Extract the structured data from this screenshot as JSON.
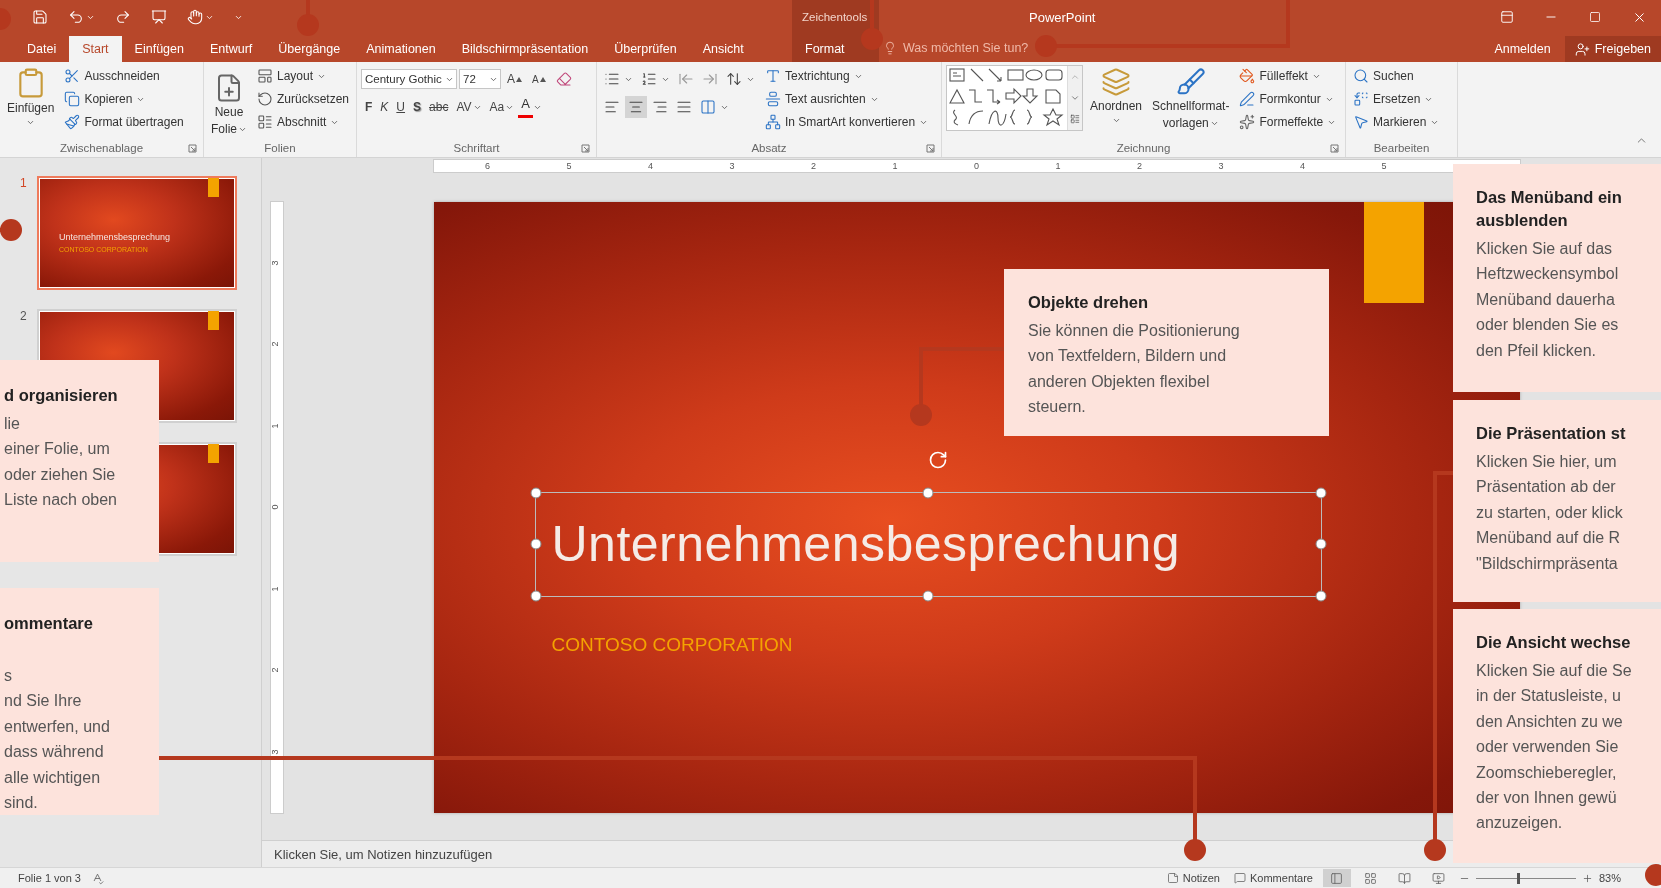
{
  "title_bar": {
    "context_label": "Zeichentools",
    "title": "PowerPoint"
  },
  "menu_tabs": [
    {
      "label": "Datei",
      "selected": false
    },
    {
      "label": "Start",
      "selected": true
    },
    {
      "label": "Einfügen",
      "selected": false
    },
    {
      "label": "Entwurf",
      "selected": false
    },
    {
      "label": "Übergänge",
      "selected": false
    },
    {
      "label": "Animationen",
      "selected": false
    },
    {
      "label": "Bildschirmpräsentation",
      "selected": false
    },
    {
      "label": "Überprüfen",
      "selected": false
    },
    {
      "label": "Ansicht",
      "selected": false
    }
  ],
  "context_tab": {
    "label": "Format",
    "selected": false
  },
  "tell_me": {
    "placeholder": "Was möchten Sie tun?"
  },
  "account": {
    "sign_in": "Anmelden",
    "share": "Freigeben"
  },
  "ribbon": {
    "clipboard": {
      "label": "Zwischenablage",
      "paste": "Einfügen",
      "commands": [
        "Ausschneiden",
        "Kopieren",
        "Format übertragen"
      ]
    },
    "slides": {
      "label": "Folien",
      "new_slide": [
        "Neue",
        "Folie"
      ],
      "commands": [
        "Layout",
        "Zurücksetzen",
        "Abschnitt"
      ]
    },
    "font": {
      "label": "Schriftart",
      "font_name": "Century Gothic",
      "font_size": "72",
      "grow": "A",
      "shrink": "A",
      "format_buttons": [
        "F",
        "K",
        "U",
        "S",
        "abc",
        "AV",
        "Aa"
      ],
      "font_color": "A"
    },
    "paragraph": {
      "label": "Absatz",
      "alignments": [
        {
          "selected": false
        },
        {
          "selected": true
        },
        {
          "selected": false
        },
        {
          "selected": false
        }
      ],
      "commands": [
        "Textrichtung",
        "Text ausrichten",
        "In SmartArt konvertieren"
      ]
    },
    "drawing": {
      "label": "Zeichnung",
      "arrange": "Anordnen",
      "quick_styles": [
        "Schnellformat-",
        "vorlagen"
      ],
      "commands": [
        "Fülleffekt",
        "Formkontur",
        "Formeffekte"
      ]
    },
    "editing": {
      "label": "Bearbeiten",
      "commands": [
        "Suchen",
        "Ersetzen",
        "Markieren"
      ]
    }
  },
  "slide_panel": {
    "slides": [
      {
        "number": "1",
        "selected": true,
        "title": "Unternehmensbesprechung",
        "subtitle": "CONTOSO CORPORATION"
      },
      {
        "number": "2",
        "selected": false
      },
      {
        "selected": false
      }
    ]
  },
  "rulers": {
    "horizontal": [
      "6",
      "5",
      "4",
      "3",
      "2",
      "1",
      "0",
      "1",
      "2",
      "3",
      "4",
      "5"
    ],
    "vertical": [
      "3",
      "2",
      "1",
      "0",
      "1",
      "2",
      "3"
    ]
  },
  "slide": {
    "title": "Unternehmensbesprechung",
    "subtitle": "CONTOSO CORPORATION",
    "title_selected": true
  },
  "notes": {
    "prompt": "Klicken Sie, um Notizen hinzuzufügen"
  },
  "callouts": [
    {
      "title_lines": [
        "Objekte drehen"
      ],
      "body_lines": [
        "Sie können die Positionierung",
        "von Textfeldern, Bildern und",
        "anderen Objekten flexibel",
        "steuern."
      ]
    },
    {
      "title_lines": [
        "d organisieren"
      ],
      "body_lines": [
        "lie",
        "einer Folie, um",
        "oder ziehen Sie",
        "Liste nach oben"
      ]
    },
    {
      "title_lines": [
        "ommentare"
      ],
      "body_lines": [
        "s",
        "nd Sie Ihre",
        "entwerfen, und",
        "dass während",
        "alle wichtigen",
        "sind."
      ]
    },
    {
      "title_lines": [
        "Das Menüband ein",
        "ausblenden"
      ],
      "body_lines": [
        "Klicken Sie auf das",
        "Heftzweckensymbol",
        "Menüband dauerha",
        "oder blenden Sie es",
        "den Pfeil klicken."
      ]
    },
    {
      "title_lines": [
        "Die Präsentation st"
      ],
      "body_lines": [
        "Klicken Sie hier, um",
        "Präsentation ab der",
        "zu starten, oder klick",
        "Menüband auf die R",
        "\"Bildschirmpräsenta"
      ]
    },
    {
      "title_lines": [
        "Die Ansicht wechse"
      ],
      "body_lines": [
        "Klicken Sie auf die Se",
        "in der Statusleiste, u",
        "den Ansichten zu we",
        "oder verwenden Sie",
        "Zoomschieberegler,",
        "der von Ihnen gewü",
        "anzuzeigen."
      ]
    }
  ],
  "status_bar": {
    "slide_info": "Folie 1 von 3",
    "notes": "Notizen",
    "comments": "Kommentare",
    "views": [
      {
        "selected": true
      },
      {
        "selected": false
      },
      {
        "selected": false
      },
      {
        "selected": false
      }
    ],
    "zoom": {
      "level": 0.42,
      "reading": "83%"
    }
  }
}
